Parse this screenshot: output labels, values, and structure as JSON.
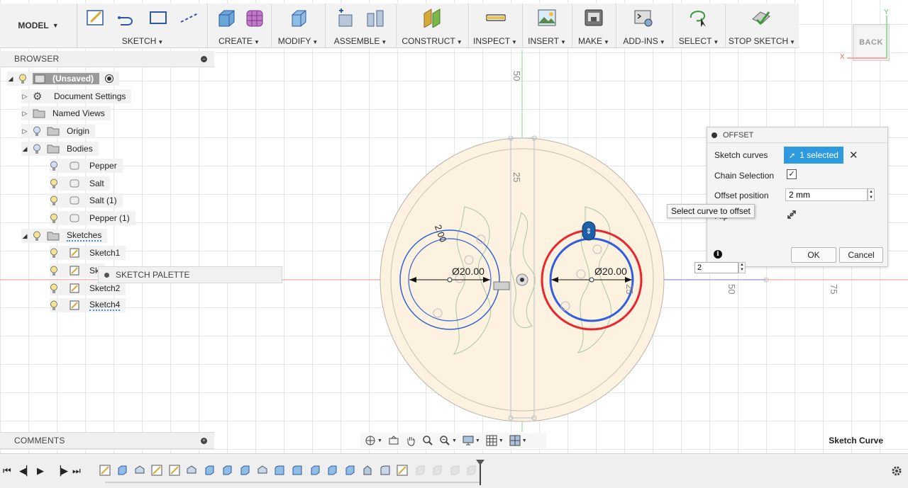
{
  "toolbar": {
    "model_label": "MODEL",
    "groups": [
      {
        "label": "SKETCH"
      },
      {
        "label": "CREATE"
      },
      {
        "label": "MODIFY"
      },
      {
        "label": "ASSEMBLE"
      },
      {
        "label": "CONSTRUCT"
      },
      {
        "label": "INSPECT"
      },
      {
        "label": "INSERT"
      },
      {
        "label": "MAKE"
      },
      {
        "label": "ADD-INS"
      },
      {
        "label": "SELECT"
      },
      {
        "label": "STOP SKETCH"
      }
    ]
  },
  "browser": {
    "title": "BROWSER",
    "root": "(Unsaved)",
    "items": [
      {
        "label": "Document Settings"
      },
      {
        "label": "Named Views"
      },
      {
        "label": "Origin"
      },
      {
        "label": "Bodies"
      },
      {
        "label": "Pepper"
      },
      {
        "label": "Salt"
      },
      {
        "label": "Salt (1)"
      },
      {
        "label": "Pepper (1)"
      },
      {
        "label": "Sketches"
      },
      {
        "label": "Sketch1"
      },
      {
        "label": "Sk"
      },
      {
        "label": "Sketch2"
      },
      {
        "label": "Sketch4"
      }
    ]
  },
  "sketch_palette": {
    "label": "SKETCH PALETTE"
  },
  "comments": {
    "title": "COMMENTS"
  },
  "viewcube": {
    "label": "BACK",
    "axis_x": "X",
    "axis_y": "Y"
  },
  "canvas": {
    "dim_left": "Ø20.00",
    "dim_right": "Ø20.00",
    "dim_angle": "2.00",
    "ruler": {
      "v50": "50",
      "v25": "25",
      "h25": "25",
      "h50": "50",
      "h75": "75"
    }
  },
  "offset_dialog": {
    "title": "OFFSET",
    "sketch_curves_label": "Sketch curves",
    "selected_label": "1 selected",
    "chain_label": "Chain Selection",
    "chain_checked": true,
    "offset_position_label": "Offset position",
    "offset_value": "2 mm",
    "flip_label": "Flip",
    "ok": "OK",
    "cancel": "Cancel"
  },
  "tooltip": "Select curve to offset",
  "inline_input_value": "2",
  "status": "Sketch Curve",
  "colors": {
    "selection_blue": "#2d9ae0",
    "curve_red": "#e8262b",
    "curve_blue": "#2f5fe0",
    "body_fill": "#fdf1e0"
  }
}
